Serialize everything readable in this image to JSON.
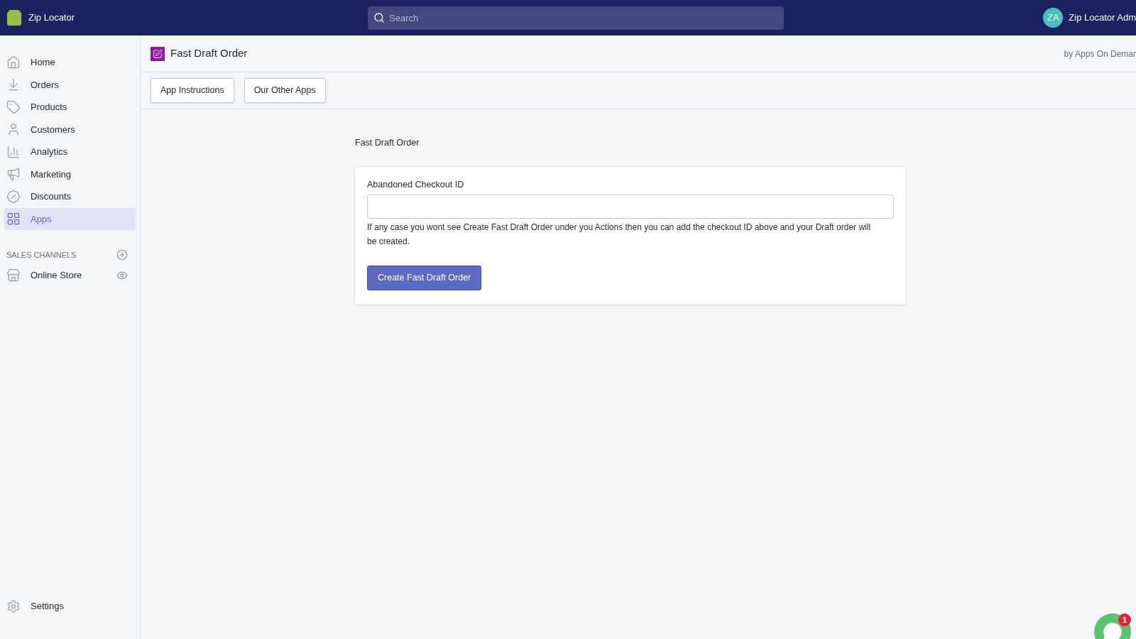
{
  "topbar": {
    "store_name": "Zip Locator",
    "search": {
      "placeholder": "Search"
    },
    "user": {
      "initials": "ZA",
      "name": "Zip Locator Adm"
    }
  },
  "sidebar": {
    "items": [
      {
        "label": "Home",
        "selected": false
      },
      {
        "label": "Orders",
        "selected": false
      },
      {
        "label": "Products",
        "selected": false
      },
      {
        "label": "Customers",
        "selected": false
      },
      {
        "label": "Analytics",
        "selected": false
      },
      {
        "label": "Marketing",
        "selected": false
      },
      {
        "label": "Discounts",
        "selected": false
      },
      {
        "label": "Apps",
        "selected": true
      }
    ],
    "sales_channels": {
      "heading": "SALES CHANNELS",
      "items": [
        {
          "label": "Online Store"
        }
      ]
    },
    "settings": {
      "label": "Settings"
    }
  },
  "app_header": {
    "title": "Fast Draft Order",
    "byline": "by Apps On Demar"
  },
  "toolbar": {
    "buttons": [
      "App Instructions",
      "Our Other Apps"
    ]
  },
  "page": {
    "heading": "Fast Draft Order",
    "form": {
      "label": "Abandoned Checkout ID",
      "help": "If any case you wont see Create Fast Draft Order under you Actions then you can add the checkout ID above and your Draft order will be created.",
      "submit": "Create Fast Draft Order"
    }
  },
  "chat": {
    "badge": "1"
  }
}
